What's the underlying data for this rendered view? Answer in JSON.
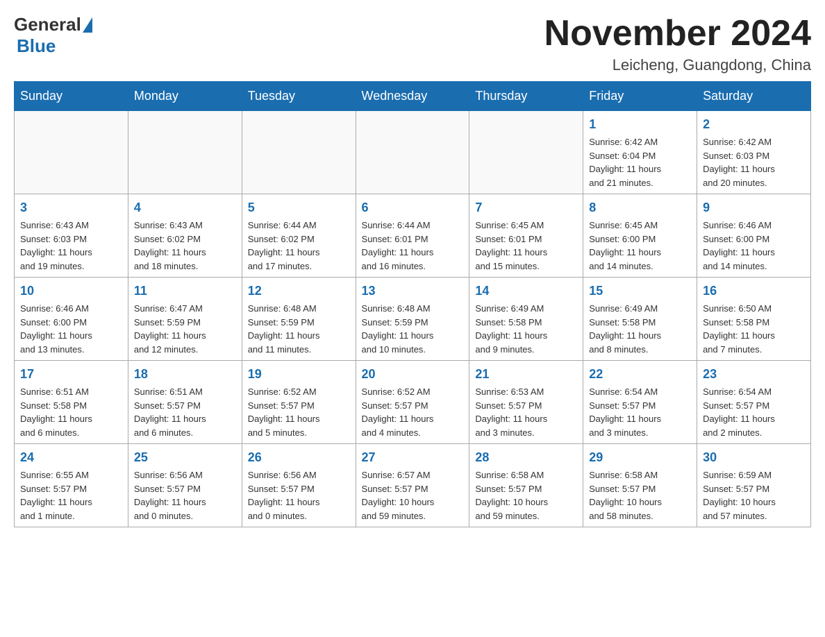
{
  "header": {
    "logo": {
      "general": "General",
      "blue": "Blue"
    },
    "title": "November 2024",
    "location": "Leicheng, Guangdong, China"
  },
  "days_of_week": [
    "Sunday",
    "Monday",
    "Tuesday",
    "Wednesday",
    "Thursday",
    "Friday",
    "Saturday"
  ],
  "weeks": [
    [
      {
        "day": "",
        "info": ""
      },
      {
        "day": "",
        "info": ""
      },
      {
        "day": "",
        "info": ""
      },
      {
        "day": "",
        "info": ""
      },
      {
        "day": "",
        "info": ""
      },
      {
        "day": "1",
        "info": "Sunrise: 6:42 AM\nSunset: 6:04 PM\nDaylight: 11 hours\nand 21 minutes."
      },
      {
        "day": "2",
        "info": "Sunrise: 6:42 AM\nSunset: 6:03 PM\nDaylight: 11 hours\nand 20 minutes."
      }
    ],
    [
      {
        "day": "3",
        "info": "Sunrise: 6:43 AM\nSunset: 6:03 PM\nDaylight: 11 hours\nand 19 minutes."
      },
      {
        "day": "4",
        "info": "Sunrise: 6:43 AM\nSunset: 6:02 PM\nDaylight: 11 hours\nand 18 minutes."
      },
      {
        "day": "5",
        "info": "Sunrise: 6:44 AM\nSunset: 6:02 PM\nDaylight: 11 hours\nand 17 minutes."
      },
      {
        "day": "6",
        "info": "Sunrise: 6:44 AM\nSunset: 6:01 PM\nDaylight: 11 hours\nand 16 minutes."
      },
      {
        "day": "7",
        "info": "Sunrise: 6:45 AM\nSunset: 6:01 PM\nDaylight: 11 hours\nand 15 minutes."
      },
      {
        "day": "8",
        "info": "Sunrise: 6:45 AM\nSunset: 6:00 PM\nDaylight: 11 hours\nand 14 minutes."
      },
      {
        "day": "9",
        "info": "Sunrise: 6:46 AM\nSunset: 6:00 PM\nDaylight: 11 hours\nand 14 minutes."
      }
    ],
    [
      {
        "day": "10",
        "info": "Sunrise: 6:46 AM\nSunset: 6:00 PM\nDaylight: 11 hours\nand 13 minutes."
      },
      {
        "day": "11",
        "info": "Sunrise: 6:47 AM\nSunset: 5:59 PM\nDaylight: 11 hours\nand 12 minutes."
      },
      {
        "day": "12",
        "info": "Sunrise: 6:48 AM\nSunset: 5:59 PM\nDaylight: 11 hours\nand 11 minutes."
      },
      {
        "day": "13",
        "info": "Sunrise: 6:48 AM\nSunset: 5:59 PM\nDaylight: 11 hours\nand 10 minutes."
      },
      {
        "day": "14",
        "info": "Sunrise: 6:49 AM\nSunset: 5:58 PM\nDaylight: 11 hours\nand 9 minutes."
      },
      {
        "day": "15",
        "info": "Sunrise: 6:49 AM\nSunset: 5:58 PM\nDaylight: 11 hours\nand 8 minutes."
      },
      {
        "day": "16",
        "info": "Sunrise: 6:50 AM\nSunset: 5:58 PM\nDaylight: 11 hours\nand 7 minutes."
      }
    ],
    [
      {
        "day": "17",
        "info": "Sunrise: 6:51 AM\nSunset: 5:58 PM\nDaylight: 11 hours\nand 6 minutes."
      },
      {
        "day": "18",
        "info": "Sunrise: 6:51 AM\nSunset: 5:57 PM\nDaylight: 11 hours\nand 6 minutes."
      },
      {
        "day": "19",
        "info": "Sunrise: 6:52 AM\nSunset: 5:57 PM\nDaylight: 11 hours\nand 5 minutes."
      },
      {
        "day": "20",
        "info": "Sunrise: 6:52 AM\nSunset: 5:57 PM\nDaylight: 11 hours\nand 4 minutes."
      },
      {
        "day": "21",
        "info": "Sunrise: 6:53 AM\nSunset: 5:57 PM\nDaylight: 11 hours\nand 3 minutes."
      },
      {
        "day": "22",
        "info": "Sunrise: 6:54 AM\nSunset: 5:57 PM\nDaylight: 11 hours\nand 3 minutes."
      },
      {
        "day": "23",
        "info": "Sunrise: 6:54 AM\nSunset: 5:57 PM\nDaylight: 11 hours\nand 2 minutes."
      }
    ],
    [
      {
        "day": "24",
        "info": "Sunrise: 6:55 AM\nSunset: 5:57 PM\nDaylight: 11 hours\nand 1 minute."
      },
      {
        "day": "25",
        "info": "Sunrise: 6:56 AM\nSunset: 5:57 PM\nDaylight: 11 hours\nand 0 minutes."
      },
      {
        "day": "26",
        "info": "Sunrise: 6:56 AM\nSunset: 5:57 PM\nDaylight: 11 hours\nand 0 minutes."
      },
      {
        "day": "27",
        "info": "Sunrise: 6:57 AM\nSunset: 5:57 PM\nDaylight: 10 hours\nand 59 minutes."
      },
      {
        "day": "28",
        "info": "Sunrise: 6:58 AM\nSunset: 5:57 PM\nDaylight: 10 hours\nand 59 minutes."
      },
      {
        "day": "29",
        "info": "Sunrise: 6:58 AM\nSunset: 5:57 PM\nDaylight: 10 hours\nand 58 minutes."
      },
      {
        "day": "30",
        "info": "Sunrise: 6:59 AM\nSunset: 5:57 PM\nDaylight: 10 hours\nand 57 minutes."
      }
    ]
  ]
}
